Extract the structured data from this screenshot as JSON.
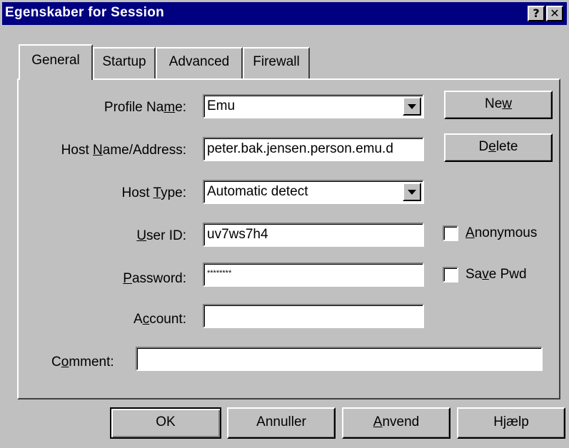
{
  "window": {
    "title": "Egenskaber for Session",
    "help_button": "?",
    "close_button": "✕"
  },
  "tabs": [
    {
      "label": "General",
      "active": true
    },
    {
      "label": "Startup",
      "active": false
    },
    {
      "label": "Advanced",
      "active": false
    },
    {
      "label": "Firewall",
      "active": false
    }
  ],
  "form": {
    "profile_name": {
      "label_pre": "Profile Na",
      "label_u": "m",
      "label_post": "e:",
      "value": "Emu"
    },
    "host_name": {
      "label_pre": "Host ",
      "label_u": "N",
      "label_post": "ame/Address:",
      "value": "peter.bak.jensen.person.emu.d"
    },
    "host_type": {
      "label_pre": "Host ",
      "label_u": "T",
      "label_post": "ype:",
      "value": "Automatic detect"
    },
    "user_id": {
      "label_pre": "",
      "label_u": "U",
      "label_post": "ser ID:",
      "value": "uv7ws7h4"
    },
    "password": {
      "label_pre": "",
      "label_u": "P",
      "label_post": "assword:",
      "value": "********"
    },
    "account": {
      "label_pre": "A",
      "label_u": "c",
      "label_post": "count:",
      "value": ""
    },
    "comment": {
      "label_pre": "C",
      "label_u": "o",
      "label_post": "mment:",
      "value": ""
    }
  },
  "side_buttons": {
    "new": {
      "pre": "Ne",
      "u": "w",
      "post": ""
    },
    "delete": {
      "pre": "D",
      "u": "e",
      "post": "lete"
    }
  },
  "checkboxes": {
    "anonymous": {
      "pre": "",
      "u": "A",
      "post": "nonymous",
      "checked": false
    },
    "save_pwd": {
      "pre": "Sa",
      "u": "v",
      "post": "e Pwd",
      "checked": false
    }
  },
  "footer": {
    "ok": "OK",
    "cancel": "Annuller",
    "apply": {
      "pre": "",
      "u": "A",
      "post": "nvend"
    },
    "help": "Hjælp"
  }
}
